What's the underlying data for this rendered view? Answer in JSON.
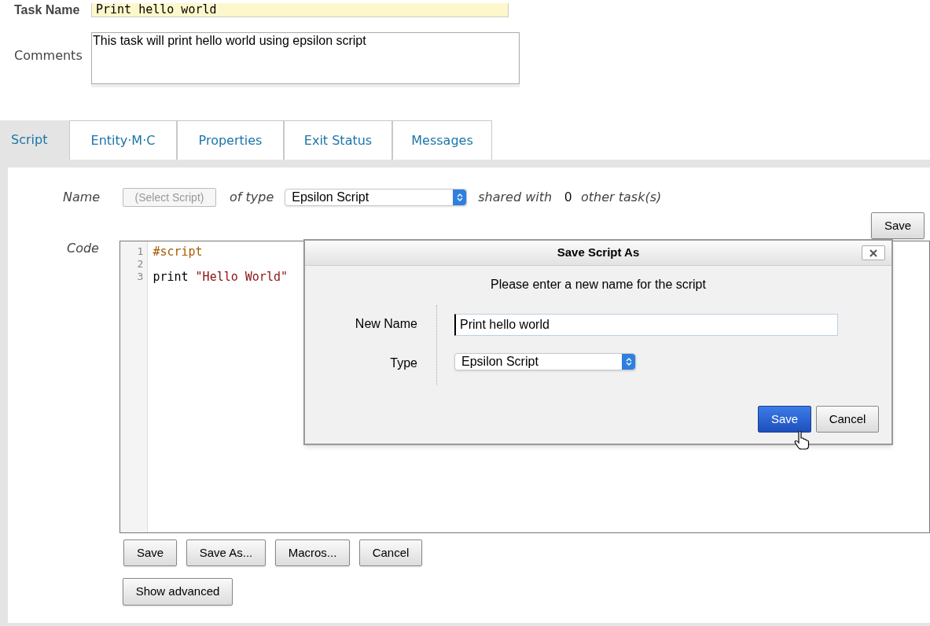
{
  "task": {
    "name_label": "Task Name",
    "name_value": "Print hello world",
    "comments_label": "Comments",
    "comments_value": "This task will print hello world using epsilon script"
  },
  "tabs": [
    {
      "label": "Script",
      "selected": true
    },
    {
      "label": "Entity·M·C",
      "selected": false
    },
    {
      "label": "Properties",
      "selected": false
    },
    {
      "label": "Exit Status",
      "selected": false
    },
    {
      "label": "Messages",
      "selected": false
    }
  ],
  "script": {
    "name_label": "Name",
    "select_button": "(Select Script)",
    "of_type_label": "of type",
    "type_value": "Epsilon Script",
    "shared_with_label": "shared with",
    "shared_count": "0",
    "other_tasks_label": "other task(s)",
    "save_button": "Save",
    "code_label": "Code",
    "code_lines": [
      {
        "number": "1",
        "tokens": [
          {
            "text": "#script",
            "kind": "comment"
          }
        ]
      },
      {
        "number": "2"
      },
      {
        "number": "3",
        "tokens": [
          {
            "text": "print ",
            "kind": "plain"
          },
          {
            "text": "\"Hello World\"",
            "kind": "string"
          }
        ]
      }
    ]
  },
  "buttons": [
    "Save",
    "Save As...",
    "Macros...",
    "Cancel"
  ],
  "show_advanced": "Show advanced",
  "dialog": {
    "title": "Save Script As",
    "message": "Please enter a new name for the script",
    "fields": [
      {
        "label": "New Name",
        "kind": "text",
        "value": "Print hello world"
      },
      {
        "label": "Type",
        "kind": "select",
        "value": "Epsilon Script"
      }
    ],
    "buttons": [
      {
        "label": "Save",
        "primary": true
      },
      {
        "label": "Cancel",
        "primary": false
      }
    ]
  }
}
